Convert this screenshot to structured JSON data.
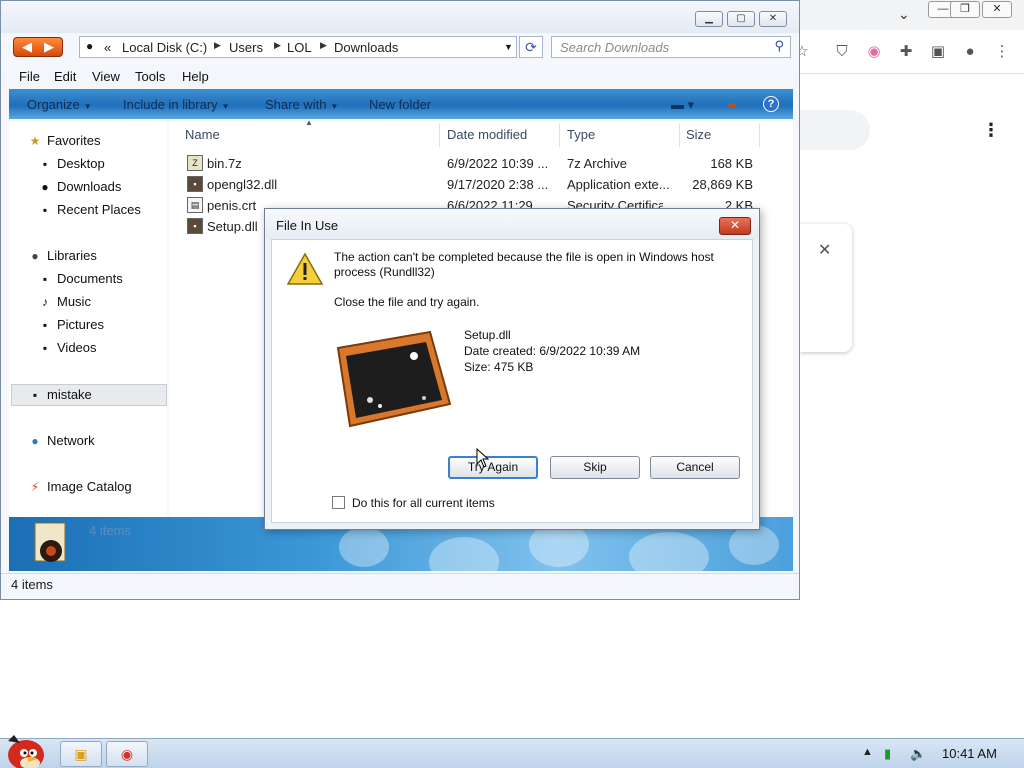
{
  "explorer": {
    "breadcrumb": [
      "Local Disk (C:)",
      "Users",
      "LOL",
      "Downloads"
    ],
    "breadcrumb_prefix": "«",
    "search_placeholder": "Search Downloads",
    "menu": [
      "File",
      "Edit",
      "View",
      "Tools",
      "Help"
    ],
    "commands": [
      "Organize",
      "Include in library",
      "Share with",
      "New folder"
    ],
    "nav": {
      "favorites": "Favorites",
      "favorites_items": [
        "Desktop",
        "Downloads",
        "Recent Places"
      ],
      "libraries": "Libraries",
      "libraries_items": [
        "Documents",
        "Music",
        "Pictures",
        "Videos"
      ],
      "selected": "mistake",
      "network": "Network",
      "catalog": "Image Catalog"
    },
    "columns": [
      "Name",
      "Date modified",
      "Type",
      "Size"
    ],
    "files": [
      {
        "name": "bin.7z",
        "date": "6/9/2022 10:39 ...",
        "type": "7z Archive",
        "size": "168 KB"
      },
      {
        "name": "opengl32.dll",
        "date": "9/17/2020 2:38 ...",
        "type": "Application exte...",
        "size": "28,869 KB"
      },
      {
        "name": "penis.crt",
        "date": "6/6/2022 11:29 ...",
        "type": "Security Certifica...",
        "size": "2 KB"
      },
      {
        "name": "Setup.dll",
        "date": "",
        "type": "",
        "size": ""
      }
    ],
    "details_count": "4 items",
    "status_count": "4 items"
  },
  "dialog": {
    "title": "File In Use",
    "close_glyph": "✕",
    "message": "The action can't be completed because the file is open in Windows host process (Rundll32)",
    "hint": "Close the file and try again.",
    "file_name": "Setup.dll",
    "date_created": "Date created: 6/9/2022 10:39 AM",
    "size": "Size: 475 KB",
    "buttons": {
      "try_again": "Try Again",
      "skip": "Skip",
      "cancel": "Cancel"
    },
    "checkbox_label": "Do this for all current items"
  },
  "taskbar": {
    "clock": "10:41 AM"
  },
  "colors": {
    "accent": "#1f6fbb",
    "dialog_close": "#c13a1f"
  }
}
